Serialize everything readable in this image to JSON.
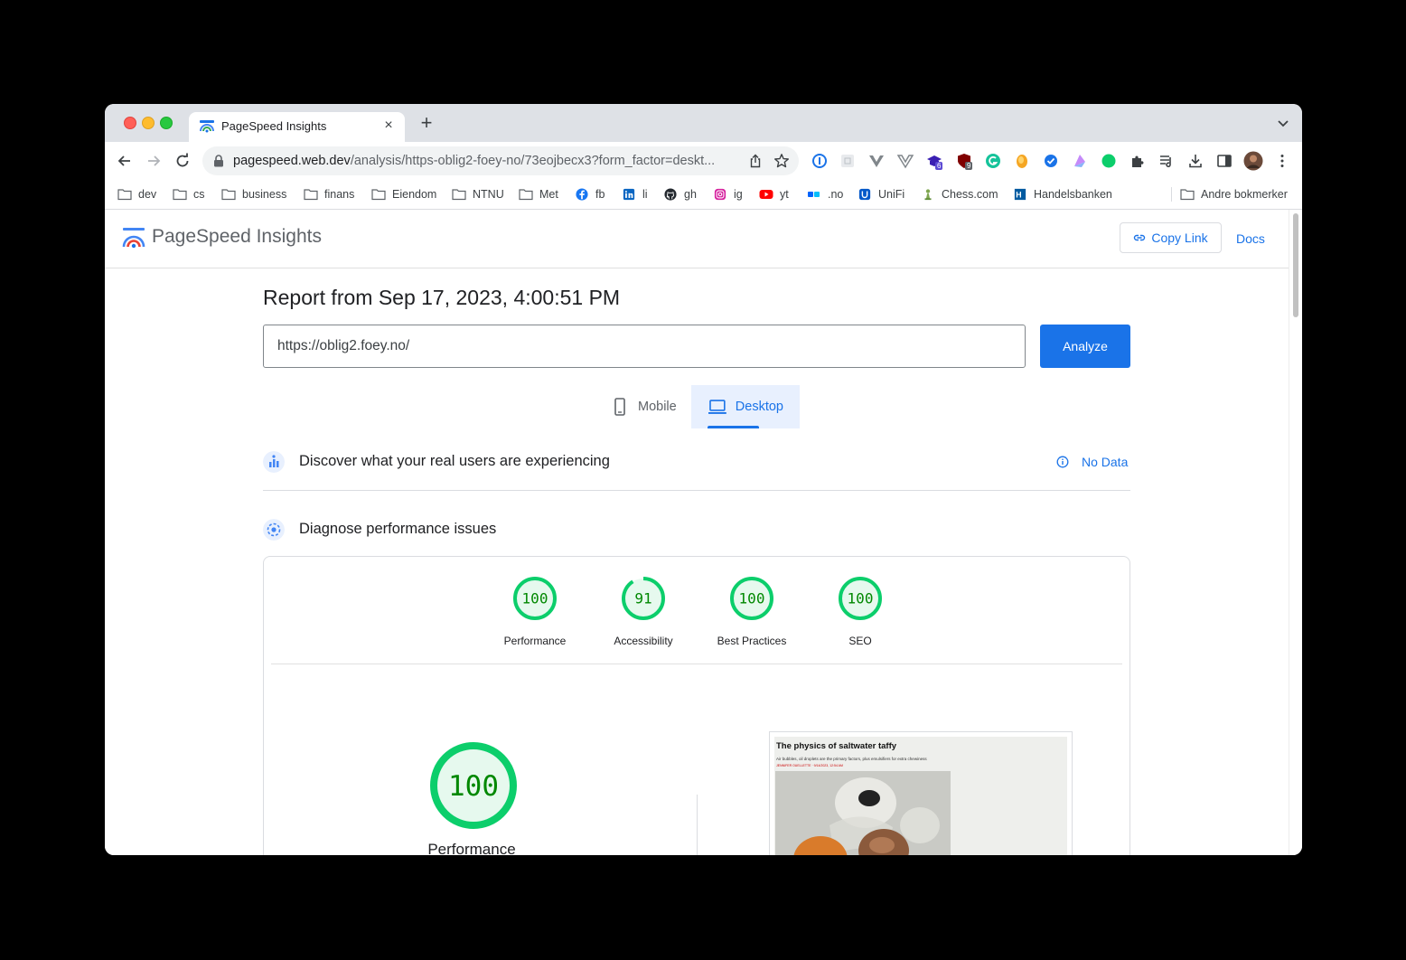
{
  "browser": {
    "tab": {
      "title": "PageSpeed Insights",
      "close": "×"
    },
    "new_tab": "+",
    "omnibox": {
      "host": "pagespeed.web.dev",
      "path": "/analysis/https-oblig2-foey-no/73eojbecx3?form_factor=deskt..."
    },
    "extensions": [
      {
        "icon": "1password-icon"
      },
      {
        "icon": "extension-grid-icon"
      },
      {
        "icon": "vue-devtools-icon"
      },
      {
        "icon": "vue-devtools-alt-icon"
      },
      {
        "icon": "graduation-cap-icon",
        "badge": "6"
      },
      {
        "icon": "ublock-shield-icon",
        "badge": "9"
      },
      {
        "icon": "grammarly-icon"
      },
      {
        "icon": "honey-icon"
      },
      {
        "icon": "check-badge-icon"
      },
      {
        "icon": "pastel-icon"
      },
      {
        "icon": "green-dot-icon"
      },
      {
        "icon": "puzzle-icon"
      },
      {
        "icon": "media-queue-icon"
      },
      {
        "icon": "download-icon"
      },
      {
        "icon": "side-panel-icon"
      },
      {
        "icon": "profile-avatar"
      },
      {
        "icon": "kebab-menu-icon"
      }
    ],
    "bookmarks": [
      {
        "label": "dev",
        "icon": "folder-icon"
      },
      {
        "label": "cs",
        "icon": "folder-icon"
      },
      {
        "label": "business",
        "icon": "folder-icon"
      },
      {
        "label": "finans",
        "icon": "folder-icon"
      },
      {
        "label": "Eiendom",
        "icon": "folder-icon"
      },
      {
        "label": "NTNU",
        "icon": "folder-icon"
      },
      {
        "label": "Met",
        "icon": "folder-icon"
      },
      {
        "label": "fb",
        "icon": "facebook-icon"
      },
      {
        "label": "li",
        "icon": "linkedin-icon"
      },
      {
        "label": "gh",
        "icon": "github-icon"
      },
      {
        "label": "ig",
        "icon": "instagram-icon"
      },
      {
        "label": "yt",
        "icon": "youtube-icon"
      },
      {
        "label": ".no",
        "icon": "finn-icon"
      },
      {
        "label": "UniFi",
        "icon": "unifi-icon"
      },
      {
        "label": "Chess.com",
        "icon": "chess-pawn-icon"
      },
      {
        "label": "Handelsbanken",
        "icon": "handelsbanken-icon"
      },
      {
        "label": "Andre bokmerker",
        "icon": "folder-icon"
      }
    ]
  },
  "psi": {
    "brand": "PageSpeed Insights",
    "copy_link": "Copy Link",
    "docs": "Docs",
    "report_title": "Report from Sep 17, 2023, 4:00:51 PM",
    "url_value": "https://oblig2.foey.no/",
    "analyze": "Analyze",
    "device_tabs": {
      "mobile": "Mobile",
      "desktop": "Desktop",
      "selected": "desktop"
    },
    "real_users": {
      "title": "Discover what your real users are experiencing",
      "status": "No Data"
    },
    "diagnose": {
      "title": "Diagnose performance issues"
    },
    "scores": [
      {
        "label": "Performance",
        "value": "100",
        "fraction": 1.0
      },
      {
        "label": "Accessibility",
        "value": "91",
        "fraction": 0.91
      },
      {
        "label": "Best Practices",
        "value": "100",
        "fraction": 1.0
      },
      {
        "label": "SEO",
        "value": "100",
        "fraction": 1.0
      }
    ],
    "main_score": {
      "label": "Performance",
      "value": "100",
      "fraction": 1.0
    },
    "screenshot": {
      "headline": "The physics of saltwater taffy",
      "subhead": "Air bubbles, oil droplets are the primary factors, plus emulsifiers for extra chewiness",
      "byline": "JENNIFER OUELLETTE · 9/14/2023, 12:54 AM"
    },
    "colors": {
      "pass": "#0cce6b",
      "pass_text": "#008800",
      "pass_fill": "#e6f9ee",
      "accent": "#1a73e8"
    }
  }
}
